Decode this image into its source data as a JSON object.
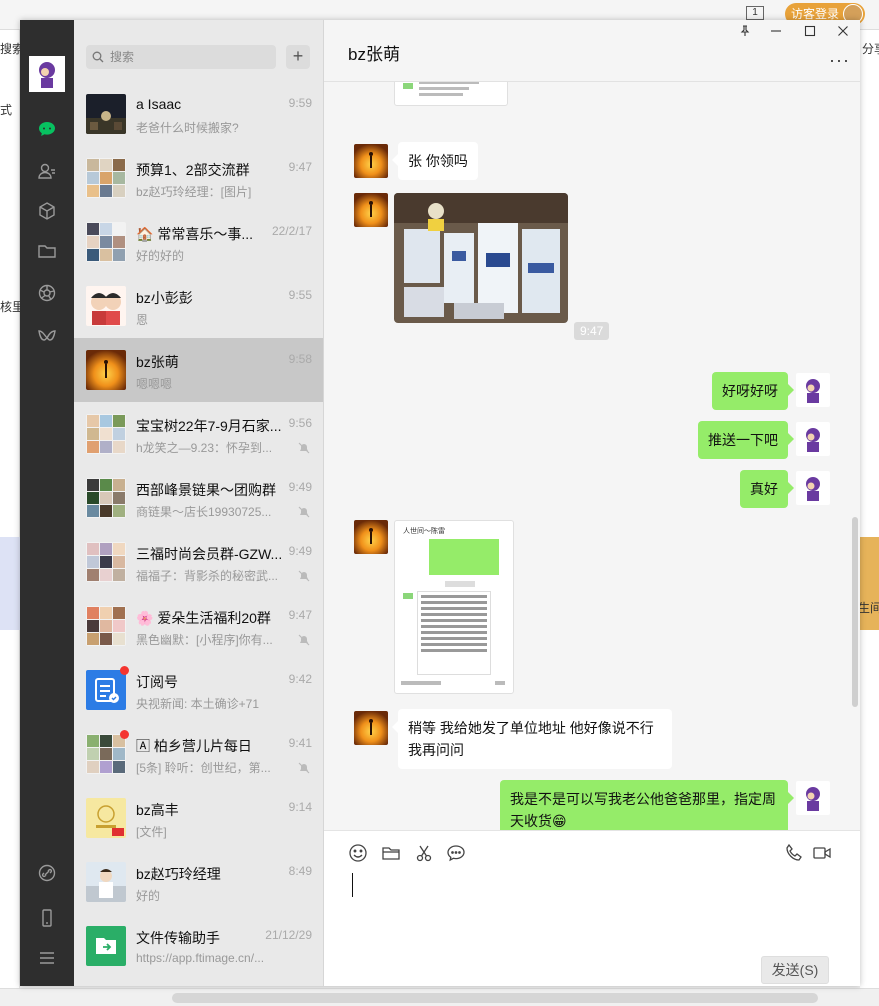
{
  "browser": {
    "left_text_top": "搜索",
    "left_text_mid": "式",
    "left_text_low": "核里",
    "right_text_top": "分享",
    "right_text_low": "生间",
    "login_label": "访客登录",
    "tab_count": "1"
  },
  "search": {
    "placeholder": "搜索"
  },
  "add_button": "+",
  "chats": [
    {
      "name": "a  Isaac",
      "preview": "老爸什么时候搬家?",
      "time": "9:59",
      "muted": false,
      "badge": false
    },
    {
      "name": "预算1、2部交流群",
      "preview": "bz赵巧玲经理：[图片]",
      "time": "9:47",
      "muted": false,
      "badge": false
    },
    {
      "name": "🏠 常常喜乐～事...",
      "preview": "好的好的",
      "time": "22/2/17",
      "muted": false,
      "badge": false
    },
    {
      "name": "bz小彭彭",
      "preview": "恩",
      "time": "9:55",
      "muted": false,
      "badge": false
    },
    {
      "name": "bz张萌",
      "preview": "嗯嗯嗯",
      "time": "9:58",
      "muted": false,
      "badge": false,
      "active": true
    },
    {
      "name": "宝宝树22年7-9月石家...",
      "preview": "h龙笑之—9.23：怀孕到...",
      "time": "9:56",
      "muted": true,
      "badge": false
    },
    {
      "name": "西部峰景链果～团购群",
      "preview": "商链果～店长19930725...",
      "time": "9:49",
      "muted": true,
      "badge": false
    },
    {
      "name": "三福时尚会员群-GZW...",
      "preview": "福福子：背影杀的秘密武...",
      "time": "9:49",
      "muted": true,
      "badge": false
    },
    {
      "name": "🌸 爱朵生活福利20群",
      "preview": "黑色幽默：[小程序]你有...",
      "time": "9:47",
      "muted": true,
      "badge": false
    },
    {
      "name": "订阅号",
      "preview": "央视新闻: 本土确诊+71",
      "time": "9:42",
      "muted": false,
      "badge": true
    },
    {
      "name": "🄰 柏乡营儿片每日",
      "preview": "[5条] 聆听：创世纪，第...",
      "time": "9:41",
      "muted": true,
      "badge": true
    },
    {
      "name": "bz高丰",
      "preview": "[文件]",
      "time": "9:14",
      "muted": false,
      "badge": false
    },
    {
      "name": "bz赵巧玲经理",
      "preview": "好的",
      "time": "8:49",
      "muted": false,
      "badge": false
    },
    {
      "name": "文件传输助手",
      "preview": "https://app.ftimage.cn/...",
      "time": "21/12/29",
      "muted": false,
      "badge": false
    }
  ],
  "chat": {
    "title": "bz张萌",
    "more": "···",
    "messages": {
      "m1": "张 你领吗",
      "timestamp": "9:47",
      "m2": "好呀好呀",
      "m3": "推送一下吧",
      "m4": "真好",
      "m5": "稍等 我给她发了单位地址 他好像说不行我再问问",
      "m6": "我是不是可以写我老公他爸爸那里，指定周天收货😁"
    },
    "screenshot_header": "人世间～陈雷"
  },
  "composer": {
    "send_label": "发送(S)"
  },
  "colors": {
    "accent": "#07c160",
    "bubble_out": "#95ec69",
    "nav_bg": "#2e2e2e"
  }
}
